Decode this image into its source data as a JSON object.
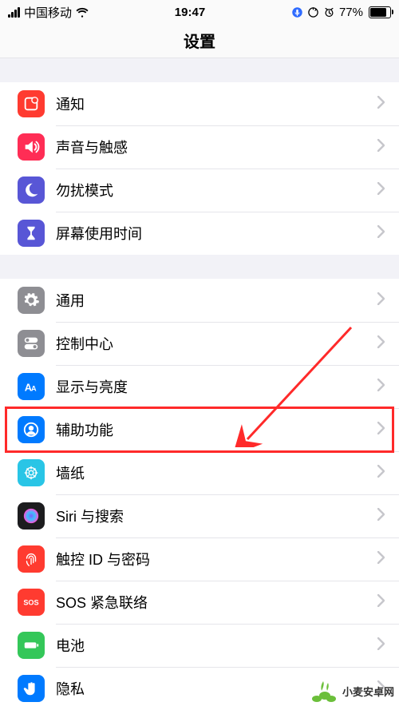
{
  "statusbar": {
    "carrier": "中国移动",
    "time": "19:47",
    "battery_pct": "77%"
  },
  "title": "设置",
  "groups": [
    {
      "items": [
        {
          "id": "notifications",
          "label": "通知",
          "iconBg": "#ff3b30",
          "icon": "notification"
        },
        {
          "id": "sounds",
          "label": "声音与触感",
          "iconBg": "#ff2d55",
          "icon": "speaker"
        },
        {
          "id": "dnd",
          "label": "勿扰模式",
          "iconBg": "#5856d6",
          "icon": "moon"
        },
        {
          "id": "screentime",
          "label": "屏幕使用时间",
          "iconBg": "#5856d6",
          "icon": "hourglass"
        }
      ]
    },
    {
      "items": [
        {
          "id": "general",
          "label": "通用",
          "iconBg": "#8e8e93",
          "icon": "gear"
        },
        {
          "id": "control-center",
          "label": "控制中心",
          "iconBg": "#8e8e93",
          "icon": "toggles"
        },
        {
          "id": "display",
          "label": "显示与亮度",
          "iconBg": "#007aff",
          "icon": "aa"
        },
        {
          "id": "accessibility",
          "label": "辅助功能",
          "iconBg": "#007aff",
          "icon": "person-circle",
          "highlighted": true
        },
        {
          "id": "wallpaper",
          "label": "墙纸",
          "iconBg": "#29c5e6",
          "icon": "flower"
        },
        {
          "id": "siri",
          "label": "Siri 与搜索",
          "iconBg": "#1c1c1e",
          "icon": "siri"
        },
        {
          "id": "touchid",
          "label": "触控 ID 与密码",
          "iconBg": "#ff3b30",
          "icon": "fingerprint"
        },
        {
          "id": "sos",
          "label": "SOS 紧急联络",
          "iconBg": "#ff3b30",
          "icon": "sos"
        },
        {
          "id": "battery",
          "label": "电池",
          "iconBg": "#34c759",
          "icon": "battery"
        },
        {
          "id": "privacy",
          "label": "隐私",
          "iconBg": "#007aff",
          "icon": "hand"
        }
      ]
    }
  ],
  "watermark": "小麦安卓网",
  "watermark_url_hint": ""
}
